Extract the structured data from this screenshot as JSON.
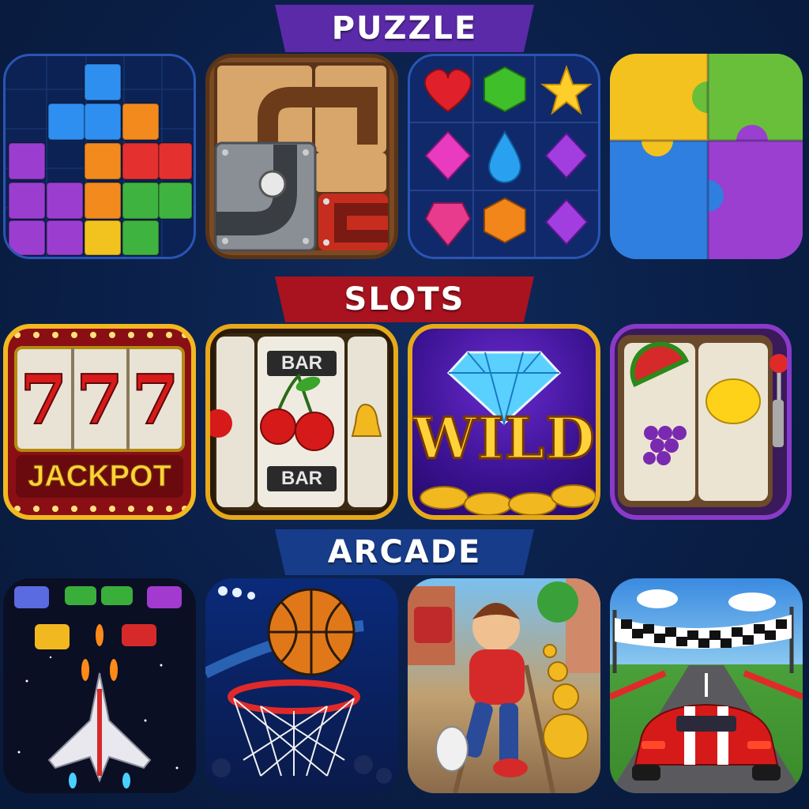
{
  "sections": {
    "puzzle": {
      "title": "PUZZLE"
    },
    "slots": {
      "title": "SLOTS"
    },
    "arcade": {
      "title": "ARCADE"
    }
  },
  "slots_text": {
    "jackpot_reels": [
      "7",
      "7",
      "7"
    ],
    "jackpot_label": "JACKPOT",
    "bar_top": "BAR",
    "bar_bottom": "BAR",
    "wild_label": "WILD"
  },
  "colors": {
    "background": "#0a1f47",
    "puzzle_banner": "#5b2aa8",
    "slots_banner": "#a8131f",
    "arcade_banner": "#173d8a",
    "gold": "#f2b820"
  },
  "tiles": [
    {
      "section": "puzzle",
      "icon": "block-puzzle-icon"
    },
    {
      "section": "puzzle",
      "icon": "pipe-slide-puzzle-icon"
    },
    {
      "section": "puzzle",
      "icon": "match-three-gems-icon"
    },
    {
      "section": "puzzle",
      "icon": "jigsaw-icon"
    },
    {
      "section": "slots",
      "icon": "jackpot-777-slot-icon"
    },
    {
      "section": "slots",
      "icon": "cherry-bar-slot-icon"
    },
    {
      "section": "slots",
      "icon": "wild-diamond-slot-icon"
    },
    {
      "section": "slots",
      "icon": "fruit-slot-machine-icon"
    },
    {
      "section": "arcade",
      "icon": "space-shooter-icon"
    },
    {
      "section": "arcade",
      "icon": "basketball-icon"
    },
    {
      "section": "arcade",
      "icon": "runner-icon"
    },
    {
      "section": "arcade",
      "icon": "racing-car-icon"
    }
  ]
}
